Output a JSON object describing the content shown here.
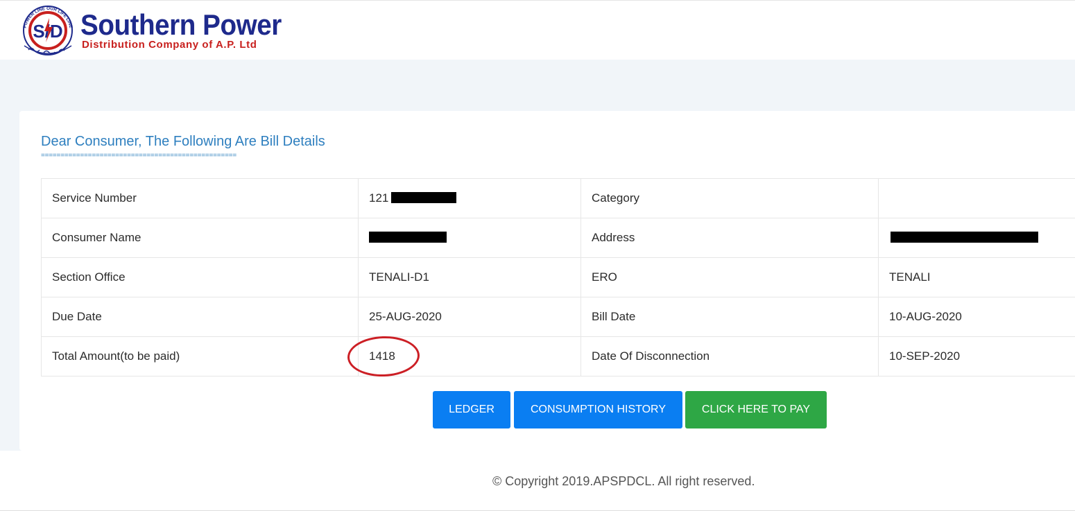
{
  "header": {
    "brand_title": "Southern Power",
    "brand_subtitle": "Distribution Company of A.P. Ltd",
    "logo_initials": "S/D",
    "logo_ring_text": "POWER LINE OUR LIFE LINE"
  },
  "bill": {
    "heading": "Dear Consumer, The Following Are Bill Details",
    "heading_underline": "==================================================",
    "rows": [
      {
        "label_a": "Service Number",
        "value_a": "121",
        "label_b": "Category",
        "value_b": ""
      },
      {
        "label_a": "Consumer Name",
        "value_a": "",
        "label_b": "Address",
        "value_b": ""
      },
      {
        "label_a": "Section Office",
        "value_a": "TENALI-D1",
        "label_b": "ERO",
        "value_b": "TENALI"
      },
      {
        "label_a": "Due Date",
        "value_a": "25-AUG-2020",
        "label_b": "Bill Date",
        "value_b": "10-AUG-2020"
      },
      {
        "label_a": "Total Amount(to be paid)",
        "value_a": "1418",
        "label_b": "Date Of Disconnection",
        "value_b": "10-SEP-2020"
      }
    ]
  },
  "actions": {
    "ledger": "LEDGER",
    "consumption_history": "CONSUMPTION HISTORY",
    "pay": "CLICK HERE TO PAY"
  },
  "footer": {
    "copyright": "© Copyright 2019.APSPDCL. All right reserved."
  },
  "colors": {
    "brand_blue": "#1e2a8c",
    "brand_red": "#c8201e",
    "heading_blue": "#2e7fbf",
    "button_blue": "#0a7ef2",
    "button_green": "#2ea745",
    "annotation_red": "#cc1f25"
  }
}
